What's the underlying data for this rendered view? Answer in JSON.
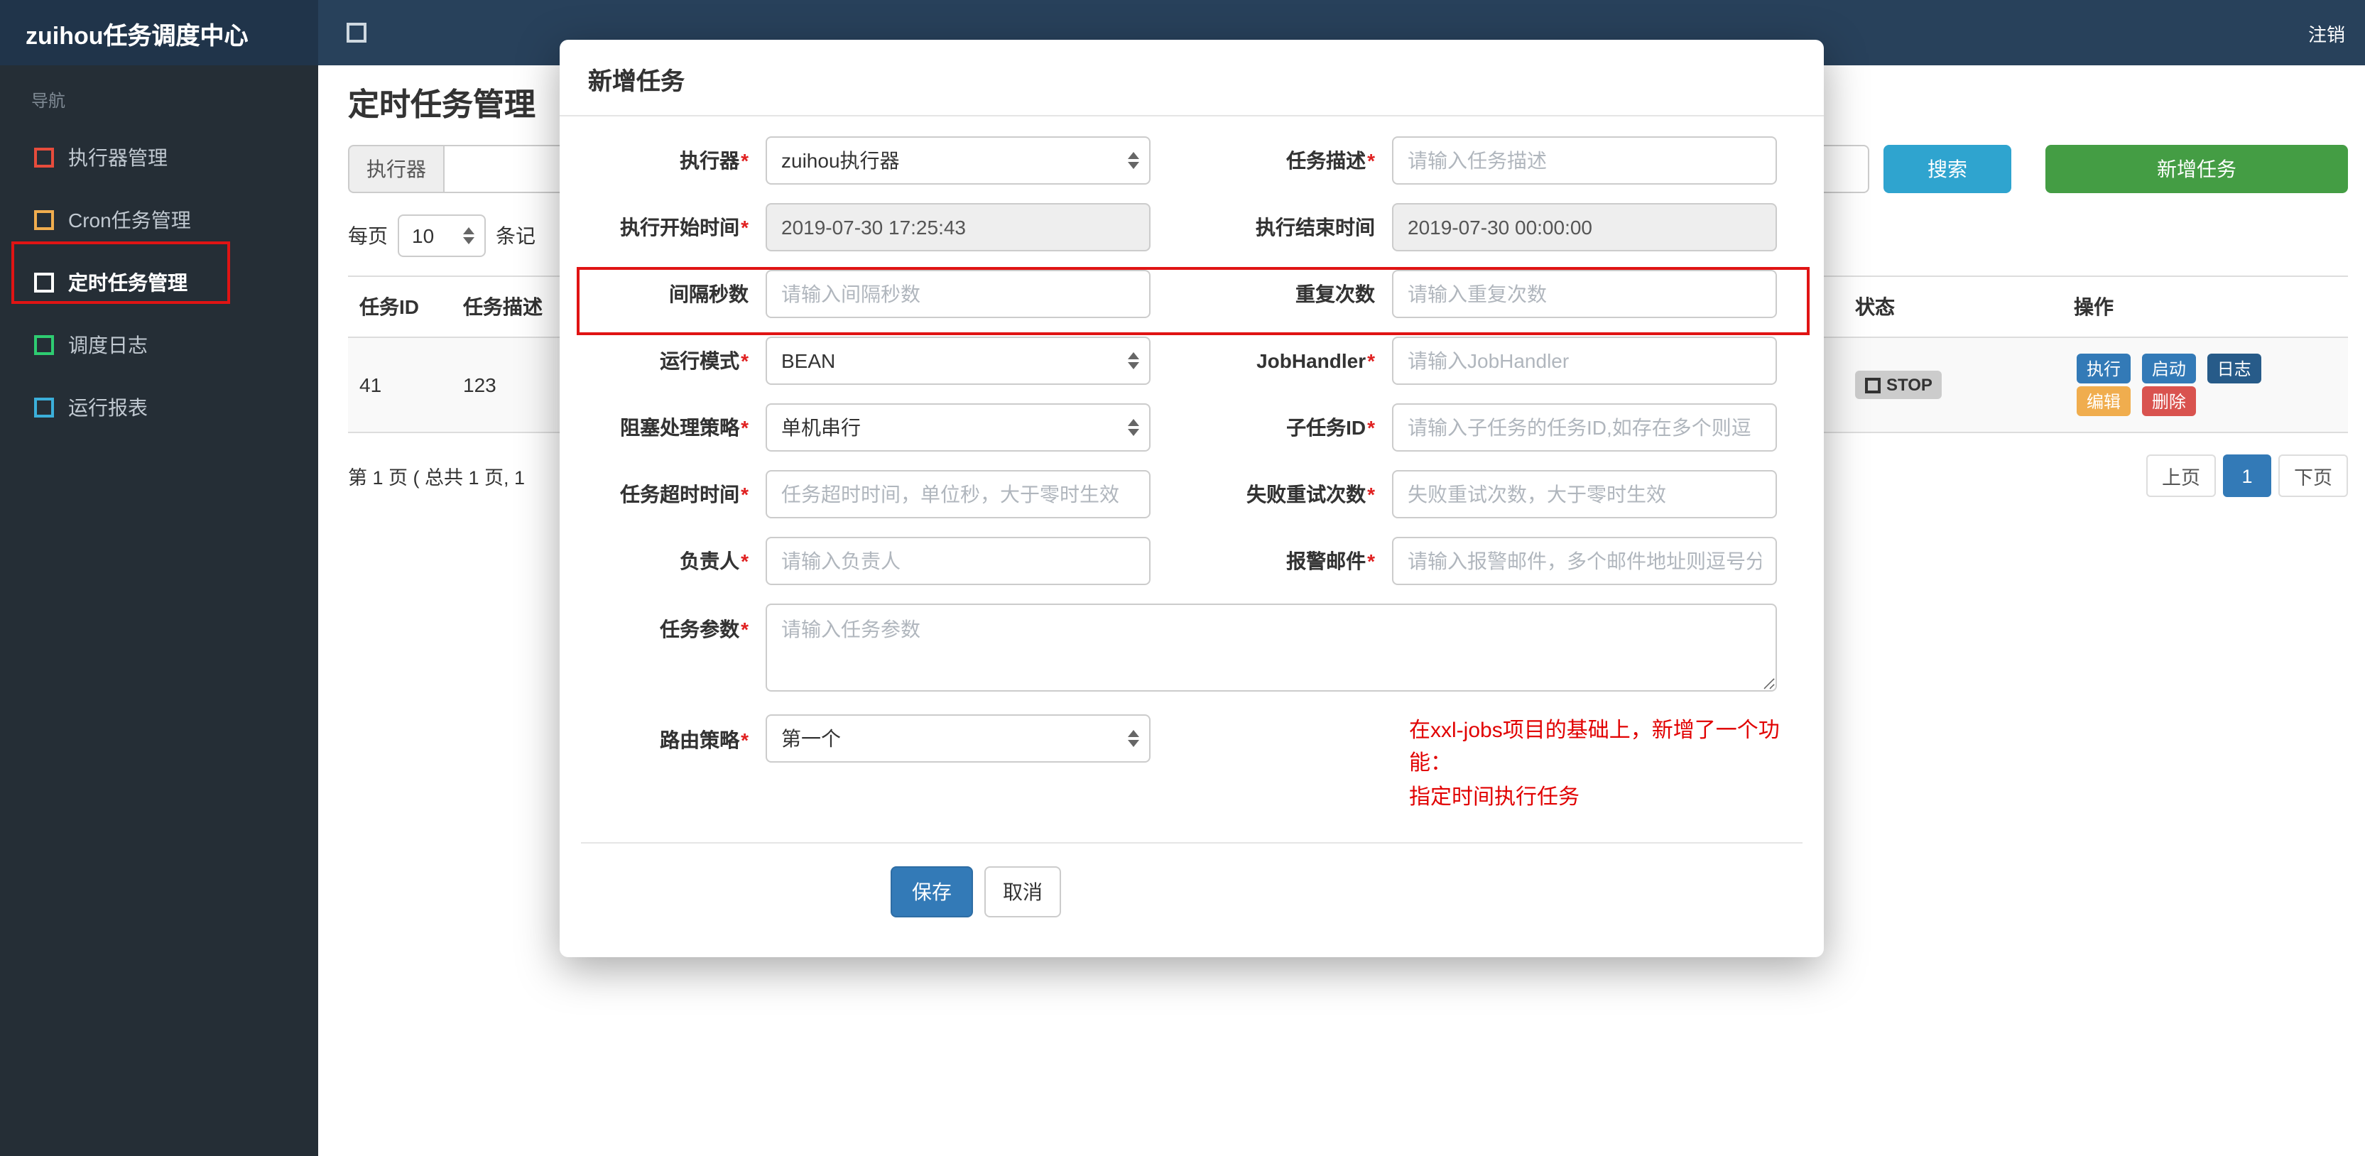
{
  "navbar": {
    "brand": "zuihou任务调度中心",
    "logout": "注销"
  },
  "icons": {
    "sidebar_toggle": "square-outline",
    "menu_item": "square-outline",
    "select_arrows": "up-down-arrows",
    "status_square": "square-outline"
  },
  "colors": {
    "navbar_bg": "#28415b",
    "brand_bg": "#20344a",
    "sidebar_bg": "#252e36",
    "annotation_red": "#e01414",
    "search_button": "#2fa4cf",
    "add_button": "#449d44",
    "save_button": "#337ab7",
    "status_badge_bg": "#cccccc",
    "note_red": "#e10000"
  },
  "sidebar": {
    "nav_label": "导航",
    "items": [
      {
        "label": "执行器管理",
        "icon_color": "#e74c3c"
      },
      {
        "label": "Cron任务管理",
        "icon_color": "#f0ad4e"
      },
      {
        "label": "定时任务管理",
        "icon_color": "#ffffff",
        "active": true,
        "annotated": true
      },
      {
        "label": "调度日志",
        "icon_color": "#2ecc71"
      },
      {
        "label": "运行报表",
        "icon_color": "#3bafda"
      }
    ]
  },
  "page": {
    "title": "定时任务管理",
    "toolbar": {
      "executor_label": "执行器",
      "search_label": "搜索",
      "add_label": "新增任务"
    },
    "page_size": {
      "prefix": "每页",
      "value": "10",
      "suffix": "条记"
    },
    "table": {
      "headers": [
        "任务ID",
        "任务描述",
        "状态",
        "操作"
      ],
      "rows": [
        {
          "task_id": "41",
          "desc": "123",
          "status": "STOP",
          "actions": [
            "执行",
            "启动",
            "日志",
            "编辑",
            "删除"
          ]
        }
      ]
    },
    "pagination": {
      "info": "第 1 页 ( 总共 1 页, 1",
      "prev": "上页",
      "page": "1",
      "next": "下页"
    }
  },
  "modal": {
    "title": "新增任务",
    "required_mark": "*",
    "rows": [
      {
        "left": {
          "label": "执行器",
          "type": "select",
          "value": "zuihou执行器"
        },
        "right": {
          "label": "任务描述",
          "type": "input",
          "placeholder": "请输入任务描述"
        }
      },
      {
        "left": {
          "label": "执行开始时间",
          "type": "readonly",
          "value": "2019-07-30 17:25:43"
        },
        "right": {
          "label": "执行结束时间",
          "type": "readonly",
          "value": "2019-07-30 00:00:00"
        }
      },
      {
        "left": {
          "label": "间隔秒数",
          "type": "input",
          "placeholder": "请输入间隔秒数"
        },
        "right": {
          "label": "重复次数",
          "type": "input",
          "placeholder": "请输入重复次数"
        }
      },
      {
        "left": {
          "label": "运行模式",
          "type": "select",
          "value": "BEAN"
        },
        "right": {
          "label": "JobHandler",
          "type": "input",
          "placeholder": "请输入JobHandler"
        }
      },
      {
        "left": {
          "label": "阻塞处理策略",
          "type": "select",
          "value": "单机串行"
        },
        "right": {
          "label": "子任务ID",
          "type": "input",
          "placeholder": "请输入子任务的任务ID,如存在多个则逗"
        }
      },
      {
        "left": {
          "label": "任务超时时间",
          "type": "input",
          "placeholder": "任务超时时间，单位秒，大于零时生效"
        },
        "right": {
          "label": "失败重试次数",
          "type": "input",
          "placeholder": "失败重试次数，大于零时生效"
        }
      },
      {
        "left": {
          "label": "负责人",
          "type": "input",
          "placeholder": "请输入负责人"
        },
        "right": {
          "label": "报警邮件",
          "type": "input",
          "placeholder": "请输入报警邮件，多个邮件地址则逗号分"
        }
      }
    ],
    "params": {
      "label": "任务参数",
      "placeholder": "请输入任务参数"
    },
    "route": {
      "label": "路由策略",
      "value": "第一个"
    },
    "note_line1": "在xxl-jobs项目的基础上，新增了一个功能：",
    "note_line2": "指定时间执行任务",
    "save": "保存",
    "cancel": "取消"
  }
}
